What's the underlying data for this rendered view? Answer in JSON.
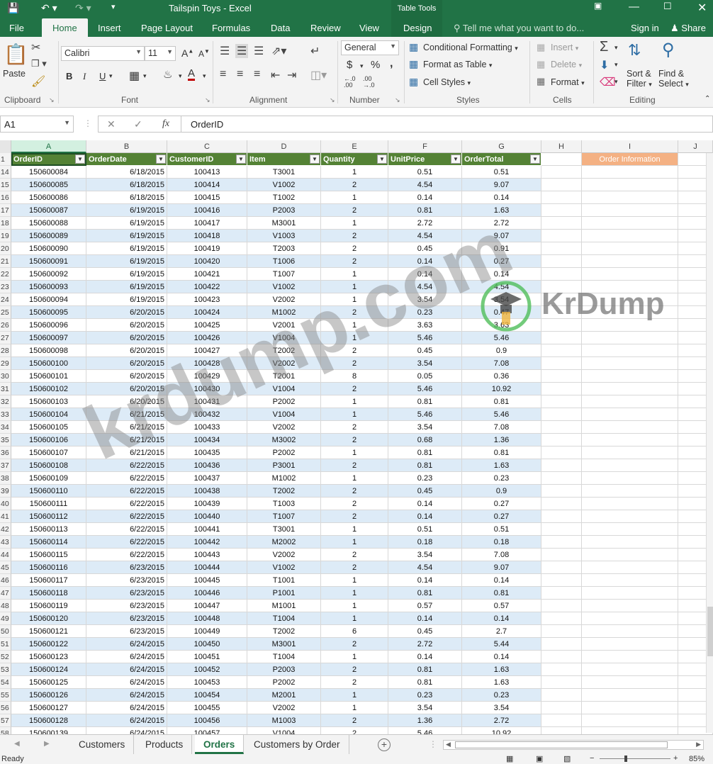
{
  "titlebar": {
    "title": "Tailspin Toys - Excel",
    "table_tools": "Table Tools",
    "colors": {
      "excel_green": "#217346"
    }
  },
  "menu": {
    "tabs": [
      "File",
      "Home",
      "Insert",
      "Page Layout",
      "Formulas",
      "Data",
      "Review",
      "View",
      "Design"
    ],
    "active": "Home",
    "tell_me": "Tell me what you want to do...",
    "sign_in": "Sign in",
    "share": "Share"
  },
  "ribbon": {
    "clipboard": {
      "paste": "Paste",
      "label": "Clipboard"
    },
    "font": {
      "name": "Calibri",
      "size": "11",
      "bold": "B",
      "italic": "I",
      "underline": "U",
      "label": "Font"
    },
    "alignment": {
      "label": "Alignment"
    },
    "number": {
      "format": "General",
      "currency": "$",
      "percent": "%",
      "comma": ",",
      "label": "Number"
    },
    "styles": {
      "conditional": "Conditional Formatting",
      "format_table": "Format as Table",
      "cell_styles": "Cell Styles",
      "label": "Styles"
    },
    "cells": {
      "insert": "Insert",
      "delete": "Delete",
      "format": "Format",
      "label": "Cells"
    },
    "editing": {
      "sort": "Sort &",
      "filter": "Filter",
      "find": "Find &",
      "select": "Select",
      "label": "Editing"
    }
  },
  "formula_bar": {
    "name_box": "A1",
    "fx": "fx",
    "formula": "OrderID"
  },
  "columns": [
    "A",
    "B",
    "C",
    "D",
    "E",
    "F",
    "G",
    "H",
    "I",
    "J"
  ],
  "table_headers": [
    "OrderID",
    "OrderDate",
    "CustomerID",
    "Item",
    "Quantity",
    "UnitPrice",
    "OrderTotal"
  ],
  "order_info_label": "Order Information",
  "rows": [
    {
      "n": "14",
      "id": "150600084",
      "date": "6/18/2015",
      "cust": "100413",
      "item": "T3001",
      "qty": "1",
      "price": "0.51",
      "total": "0.51"
    },
    {
      "n": "15",
      "id": "150600085",
      "date": "6/18/2015",
      "cust": "100414",
      "item": "V1002",
      "qty": "2",
      "price": "4.54",
      "total": "9.07"
    },
    {
      "n": "16",
      "id": "150600086",
      "date": "6/18/2015",
      "cust": "100415",
      "item": "T1002",
      "qty": "1",
      "price": "0.14",
      "total": "0.14"
    },
    {
      "n": "17",
      "id": "150600087",
      "date": "6/19/2015",
      "cust": "100416",
      "item": "P2003",
      "qty": "2",
      "price": "0.81",
      "total": "1.63"
    },
    {
      "n": "18",
      "id": "150600088",
      "date": "6/19/2015",
      "cust": "100417",
      "item": "M3001",
      "qty": "1",
      "price": "2.72",
      "total": "2.72"
    },
    {
      "n": "19",
      "id": "150600089",
      "date": "6/19/2015",
      "cust": "100418",
      "item": "V1003",
      "qty": "2",
      "price": "4.54",
      "total": "9.07"
    },
    {
      "n": "20",
      "id": "150600090",
      "date": "6/19/2015",
      "cust": "100419",
      "item": "T2003",
      "qty": "2",
      "price": "0.45",
      "total": "0.91"
    },
    {
      "n": "21",
      "id": "150600091",
      "date": "6/19/2015",
      "cust": "100420",
      "item": "T1006",
      "qty": "2",
      "price": "0.14",
      "total": "0.27"
    },
    {
      "n": "22",
      "id": "150600092",
      "date": "6/19/2015",
      "cust": "100421",
      "item": "T1007",
      "qty": "1",
      "price": "0.14",
      "total": "0.14"
    },
    {
      "n": "23",
      "id": "150600093",
      "date": "6/19/2015",
      "cust": "100422",
      "item": "V1002",
      "qty": "1",
      "price": "4.54",
      "total": "4.54"
    },
    {
      "n": "24",
      "id": "150600094",
      "date": "6/19/2015",
      "cust": "100423",
      "item": "V2002",
      "qty": "1",
      "price": "3.54",
      "total": "3.54"
    },
    {
      "n": "25",
      "id": "150600095",
      "date": "6/20/2015",
      "cust": "100424",
      "item": "M1002",
      "qty": "2",
      "price": "0.23",
      "total": "0.47"
    },
    {
      "n": "26",
      "id": "150600096",
      "date": "6/20/2015",
      "cust": "100425",
      "item": "V2001",
      "qty": "1",
      "price": "3.63",
      "total": "3.63"
    },
    {
      "n": "27",
      "id": "150600097",
      "date": "6/20/2015",
      "cust": "100426",
      "item": "V1004",
      "qty": "1",
      "price": "5.46",
      "total": "5.46"
    },
    {
      "n": "28",
      "id": "150600098",
      "date": "6/20/2015",
      "cust": "100427",
      "item": "T2002",
      "qty": "2",
      "price": "0.45",
      "total": "0.9"
    },
    {
      "n": "29",
      "id": "150600100",
      "date": "6/20/2015",
      "cust": "100428",
      "item": "V2002",
      "qty": "2",
      "price": "3.54",
      "total": "7.08"
    },
    {
      "n": "30",
      "id": "150600101",
      "date": "6/20/2015",
      "cust": "100429",
      "item": "T2001",
      "qty": "8",
      "price": "0.05",
      "total": "0.36"
    },
    {
      "n": "31",
      "id": "150600102",
      "date": "6/20/2015",
      "cust": "100430",
      "item": "V1004",
      "qty": "2",
      "price": "5.46",
      "total": "10.92"
    },
    {
      "n": "32",
      "id": "150600103",
      "date": "6/20/2015",
      "cust": "100431",
      "item": "P2002",
      "qty": "1",
      "price": "0.81",
      "total": "0.81"
    },
    {
      "n": "33",
      "id": "150600104",
      "date": "6/21/2015",
      "cust": "100432",
      "item": "V1004",
      "qty": "1",
      "price": "5.46",
      "total": "5.46"
    },
    {
      "n": "34",
      "id": "150600105",
      "date": "6/21/2015",
      "cust": "100433",
      "item": "V2002",
      "qty": "2",
      "price": "3.54",
      "total": "7.08"
    },
    {
      "n": "35",
      "id": "150600106",
      "date": "6/21/2015",
      "cust": "100434",
      "item": "M3002",
      "qty": "2",
      "price": "0.68",
      "total": "1.36"
    },
    {
      "n": "36",
      "id": "150600107",
      "date": "6/21/2015",
      "cust": "100435",
      "item": "P2002",
      "qty": "1",
      "price": "0.81",
      "total": "0.81"
    },
    {
      "n": "37",
      "id": "150600108",
      "date": "6/22/2015",
      "cust": "100436",
      "item": "P3001",
      "qty": "2",
      "price": "0.81",
      "total": "1.63"
    },
    {
      "n": "38",
      "id": "150600109",
      "date": "6/22/2015",
      "cust": "100437",
      "item": "M1002",
      "qty": "1",
      "price": "0.23",
      "total": "0.23"
    },
    {
      "n": "39",
      "id": "150600110",
      "date": "6/22/2015",
      "cust": "100438",
      "item": "T2002",
      "qty": "2",
      "price": "0.45",
      "total": "0.9"
    },
    {
      "n": "40",
      "id": "150600111",
      "date": "6/22/2015",
      "cust": "100439",
      "item": "T1003",
      "qty": "2",
      "price": "0.14",
      "total": "0.27"
    },
    {
      "n": "41",
      "id": "150600112",
      "date": "6/22/2015",
      "cust": "100440",
      "item": "T1007",
      "qty": "2",
      "price": "0.14",
      "total": "0.27"
    },
    {
      "n": "42",
      "id": "150600113",
      "date": "6/22/2015",
      "cust": "100441",
      "item": "T3001",
      "qty": "1",
      "price": "0.51",
      "total": "0.51"
    },
    {
      "n": "43",
      "id": "150600114",
      "date": "6/22/2015",
      "cust": "100442",
      "item": "M2002",
      "qty": "1",
      "price": "0.18",
      "total": "0.18"
    },
    {
      "n": "44",
      "id": "150600115",
      "date": "6/22/2015",
      "cust": "100443",
      "item": "V2002",
      "qty": "2",
      "price": "3.54",
      "total": "7.08"
    },
    {
      "n": "45",
      "id": "150600116",
      "date": "6/23/2015",
      "cust": "100444",
      "item": "V1002",
      "qty": "2",
      "price": "4.54",
      "total": "9.07"
    },
    {
      "n": "46",
      "id": "150600117",
      "date": "6/23/2015",
      "cust": "100445",
      "item": "T1001",
      "qty": "1",
      "price": "0.14",
      "total": "0.14"
    },
    {
      "n": "47",
      "id": "150600118",
      "date": "6/23/2015",
      "cust": "100446",
      "item": "P1001",
      "qty": "1",
      "price": "0.81",
      "total": "0.81"
    },
    {
      "n": "48",
      "id": "150600119",
      "date": "6/23/2015",
      "cust": "100447",
      "item": "M1001",
      "qty": "1",
      "price": "0.57",
      "total": "0.57"
    },
    {
      "n": "49",
      "id": "150600120",
      "date": "6/23/2015",
      "cust": "100448",
      "item": "T1004",
      "qty": "1",
      "price": "0.14",
      "total": "0.14"
    },
    {
      "n": "50",
      "id": "150600121",
      "date": "6/23/2015",
      "cust": "100449",
      "item": "T2002",
      "qty": "6",
      "price": "0.45",
      "total": "2.7"
    },
    {
      "n": "51",
      "id": "150600122",
      "date": "6/24/2015",
      "cust": "100450",
      "item": "M3001",
      "qty": "2",
      "price": "2.72",
      "total": "5.44"
    },
    {
      "n": "52",
      "id": "150600123",
      "date": "6/24/2015",
      "cust": "100451",
      "item": "T1004",
      "qty": "1",
      "price": "0.14",
      "total": "0.14"
    },
    {
      "n": "53",
      "id": "150600124",
      "date": "6/24/2015",
      "cust": "100452",
      "item": "P2003",
      "qty": "2",
      "price": "0.81",
      "total": "1.63"
    },
    {
      "n": "54",
      "id": "150600125",
      "date": "6/24/2015",
      "cust": "100453",
      "item": "P2002",
      "qty": "2",
      "price": "0.81",
      "total": "1.63"
    },
    {
      "n": "55",
      "id": "150600126",
      "date": "6/24/2015",
      "cust": "100454",
      "item": "M2001",
      "qty": "1",
      "price": "0.23",
      "total": "0.23"
    },
    {
      "n": "56",
      "id": "150600127",
      "date": "6/24/2015",
      "cust": "100455",
      "item": "V2002",
      "qty": "1",
      "price": "3.54",
      "total": "3.54"
    },
    {
      "n": "57",
      "id": "150600128",
      "date": "6/24/2015",
      "cust": "100456",
      "item": "M1003",
      "qty": "2",
      "price": "1.36",
      "total": "2.72"
    },
    {
      "n": "58",
      "id": "150600139",
      "date": "6/24/2015",
      "cust": "100457",
      "item": "V1004",
      "qty": "2",
      "price": "5.46",
      "total": "10.92"
    }
  ],
  "sheet_tabs": [
    "Customers",
    "Products",
    "Orders",
    "Customers by Order"
  ],
  "active_sheet": "Orders",
  "status": {
    "ready": "Ready",
    "zoom": "85%"
  },
  "watermark": {
    "diagonal": "krdump.com",
    "brand": "KrDump"
  }
}
